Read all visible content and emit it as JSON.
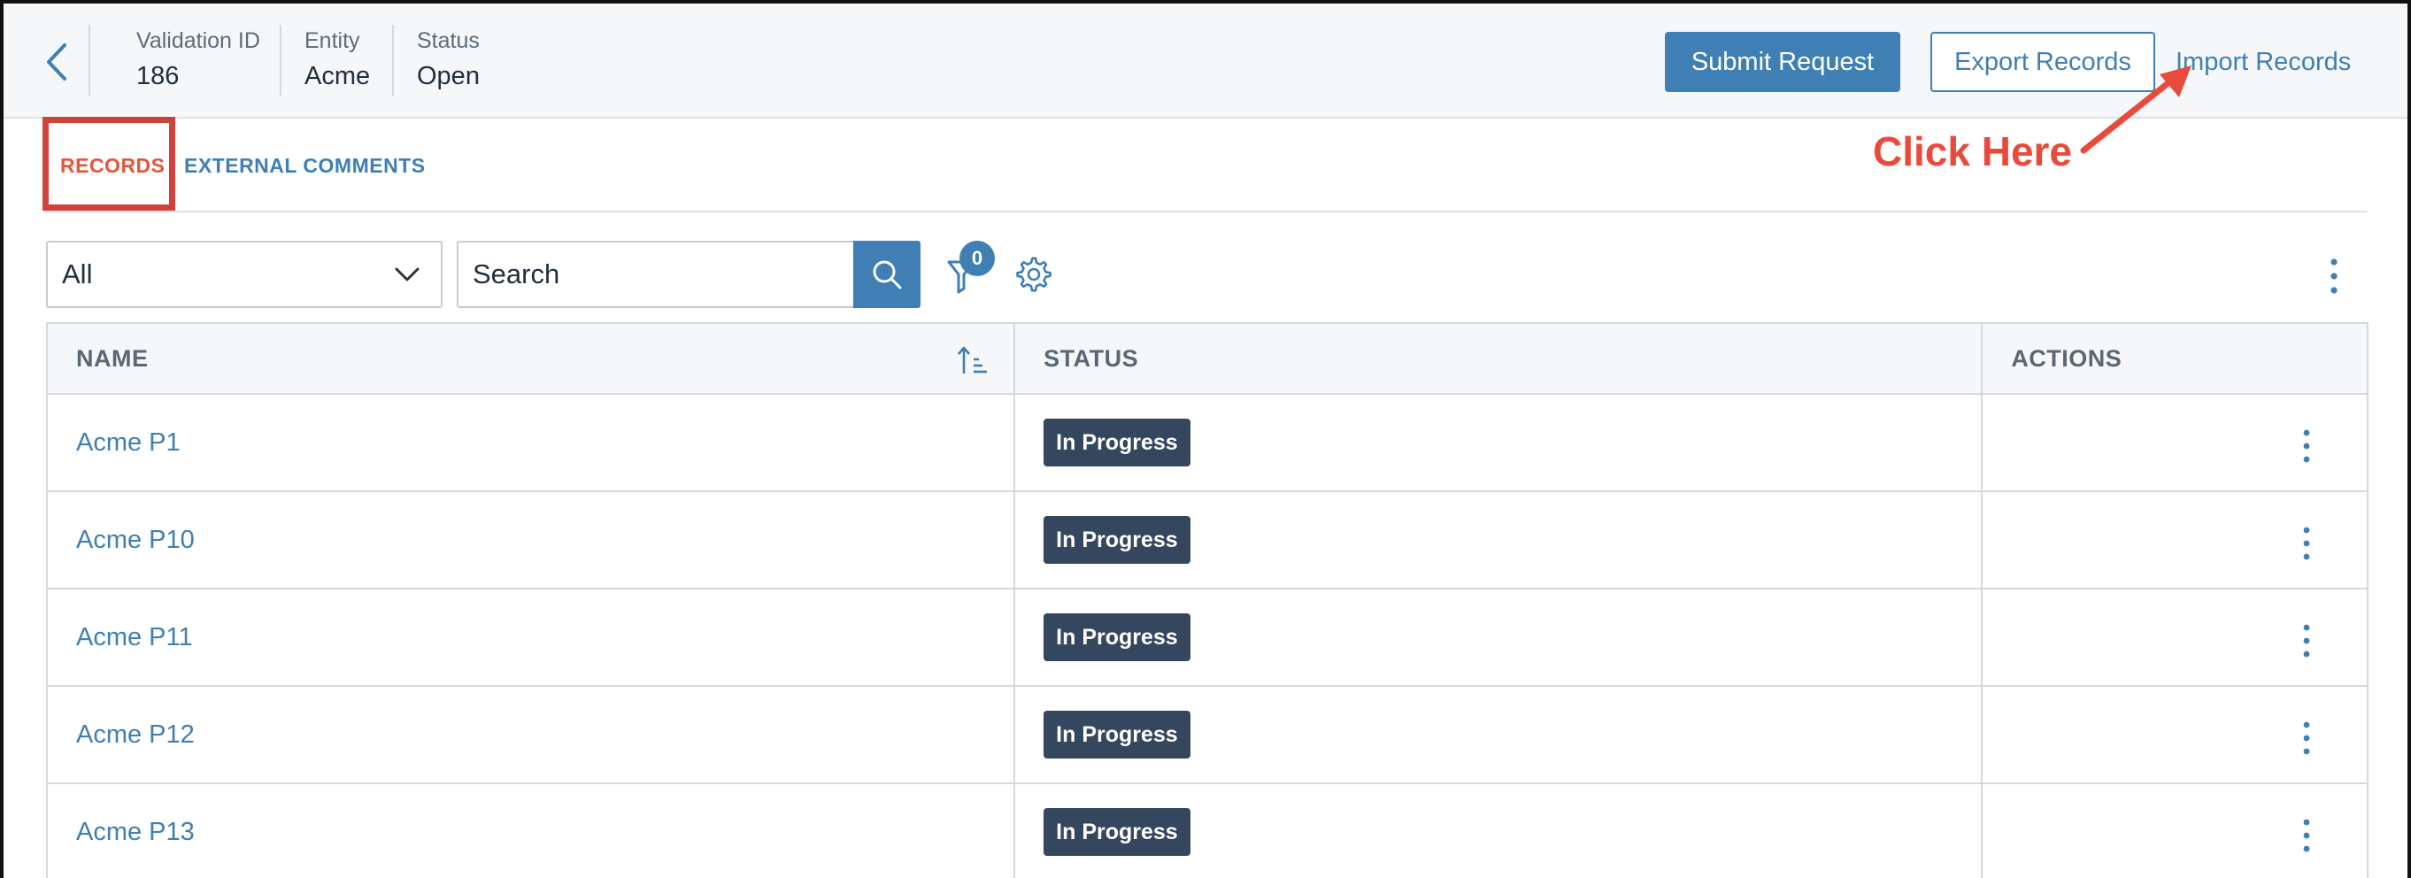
{
  "header": {
    "meta": [
      {
        "label": "Validation ID",
        "value": "186"
      },
      {
        "label": "Entity",
        "value": "Acme"
      },
      {
        "label": "Status",
        "value": "Open"
      }
    ],
    "buttons": {
      "submit": "Submit Request",
      "export": "Export Records",
      "import": "Import Records"
    }
  },
  "tabs": [
    {
      "label": "RECORDS",
      "active": true
    },
    {
      "label": "EXTERNAL COMMENTS",
      "active": false
    }
  ],
  "annotation": {
    "text": "Click Here",
    "color": "#e84b3c"
  },
  "toolbar": {
    "select_value": "All",
    "search_placeholder": "Search",
    "filter_count": "0"
  },
  "table": {
    "headers": [
      "NAME",
      "STATUS",
      "ACTIONS"
    ],
    "rows": [
      {
        "name": "Acme P1",
        "status": "In Progress"
      },
      {
        "name": "Acme P10",
        "status": "In Progress"
      },
      {
        "name": "Acme P11",
        "status": "In Progress"
      },
      {
        "name": "Acme P12",
        "status": "In Progress"
      },
      {
        "name": "Acme P13",
        "status": "In Progress"
      }
    ]
  },
  "colors": {
    "accent": "#3f7fb3",
    "active_tab": "#e4563d",
    "status_badge": "#34475f",
    "highlight": "#d1433a"
  },
  "icons": [
    "chevron-left-icon",
    "chevron-down-icon",
    "search-icon",
    "filter-icon",
    "gear-icon",
    "kebab-icon",
    "sort-ascending-icon",
    "arrow-icon"
  ]
}
